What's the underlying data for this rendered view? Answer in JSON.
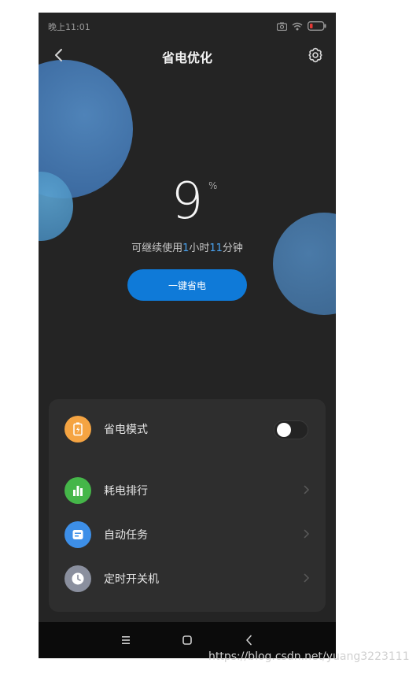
{
  "status": {
    "time": "晚上11:01"
  },
  "header": {
    "title": "省电优化"
  },
  "battery": {
    "level": "9",
    "percent_sign": "%",
    "remaining_prefix": "可继续使用",
    "hours": "1",
    "hours_unit": "小时",
    "minutes": "11",
    "minutes_unit": "分钟"
  },
  "actions": {
    "one_key_save": "一键省电"
  },
  "menu": {
    "items": [
      {
        "label": "省电模式",
        "icon": "battery-saver-icon",
        "color": "#f5a442",
        "control": "toggle",
        "on": false
      },
      {
        "label": "耗电排行",
        "icon": "bar-chart-icon",
        "color": "#45b649",
        "control": "chevron"
      },
      {
        "label": "自动任务",
        "icon": "task-icon",
        "color": "#3d8fe8",
        "control": "chevron"
      },
      {
        "label": "定时开关机",
        "icon": "clock-icon",
        "color": "#8a8f9e",
        "control": "chevron"
      }
    ]
  },
  "watermark": "https://blog.csdn.net/yuang3223111",
  "colors": {
    "accent": "#0f7ad8",
    "highlight": "#4aa3f0",
    "background": "#242424",
    "card": "#2e2e2e"
  }
}
